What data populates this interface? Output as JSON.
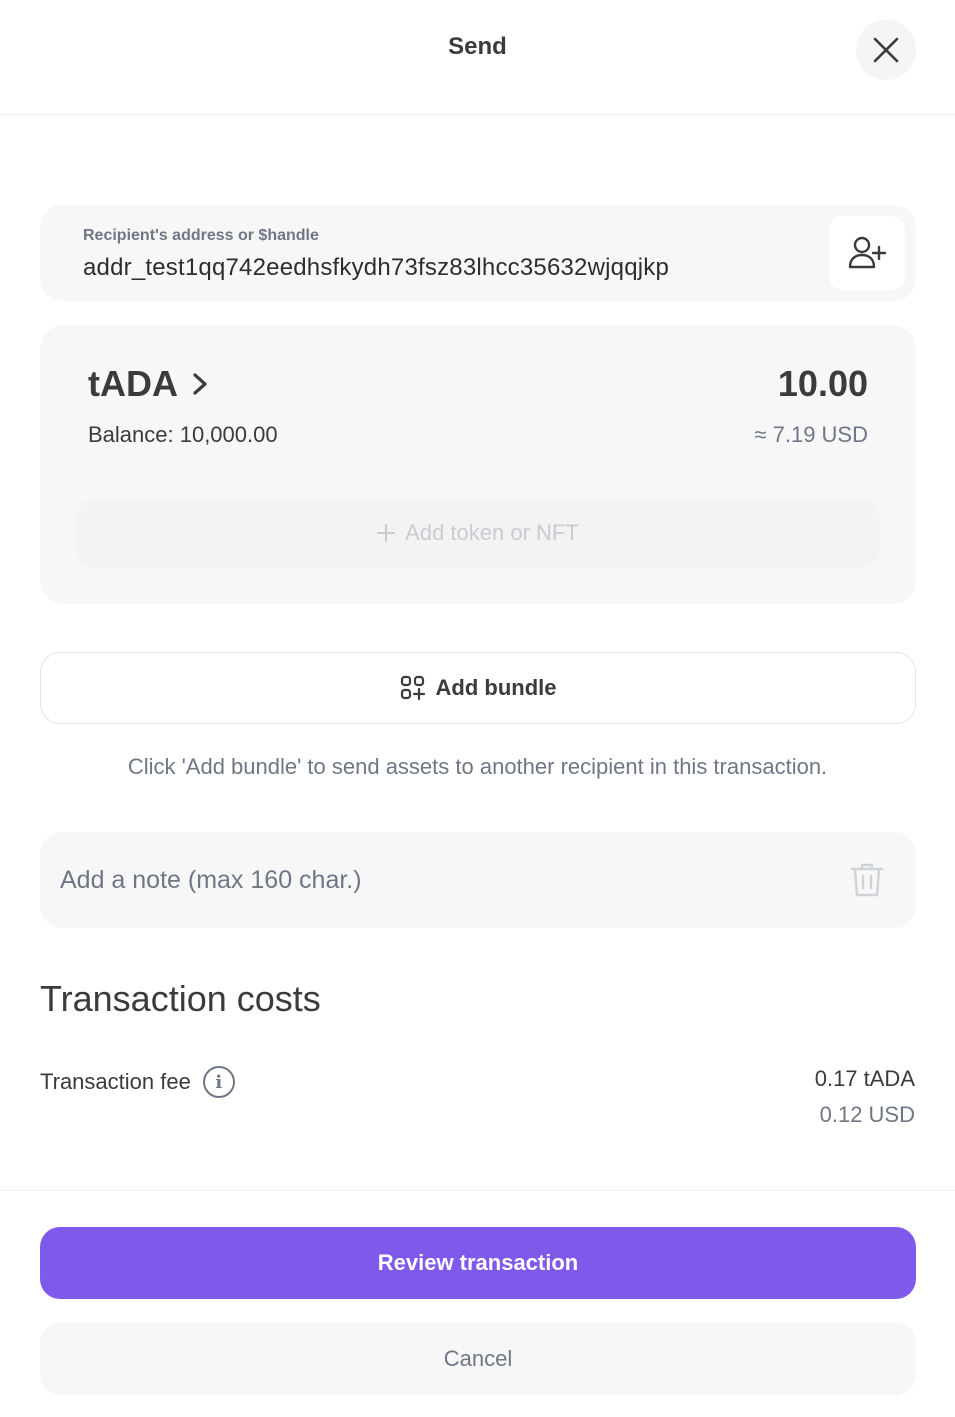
{
  "header": {
    "title": "Send",
    "close_icon": "close-icon"
  },
  "recipient": {
    "label": "Recipient's address or $handle",
    "value": "addr_test1qq742eedhsfkydh73fsz83lhcc35632wjqqjkp",
    "contact_icon": "add-contact-icon"
  },
  "asset": {
    "token": "tADA",
    "balance": "Balance: 10,000.00",
    "amount": "10.00",
    "amount_usd": "≈ 7.19 USD",
    "add_token_label": "Add token or NFT"
  },
  "bundle": {
    "button_label": "Add bundle",
    "hint": "Click 'Add bundle' to send assets to another recipient in this transaction."
  },
  "note": {
    "placeholder": "Add a note (max 160 char.)"
  },
  "costs": {
    "title": "Transaction costs",
    "fee_label": "Transaction fee",
    "fee_value": "0.17 tADA",
    "fee_usd": "0.12 USD"
  },
  "footer": {
    "review_label": "Review transaction",
    "cancel_label": "Cancel"
  },
  "colors": {
    "accent": "#7f59ea",
    "muted": "#6f7786",
    "card": "#f7f7f7"
  }
}
